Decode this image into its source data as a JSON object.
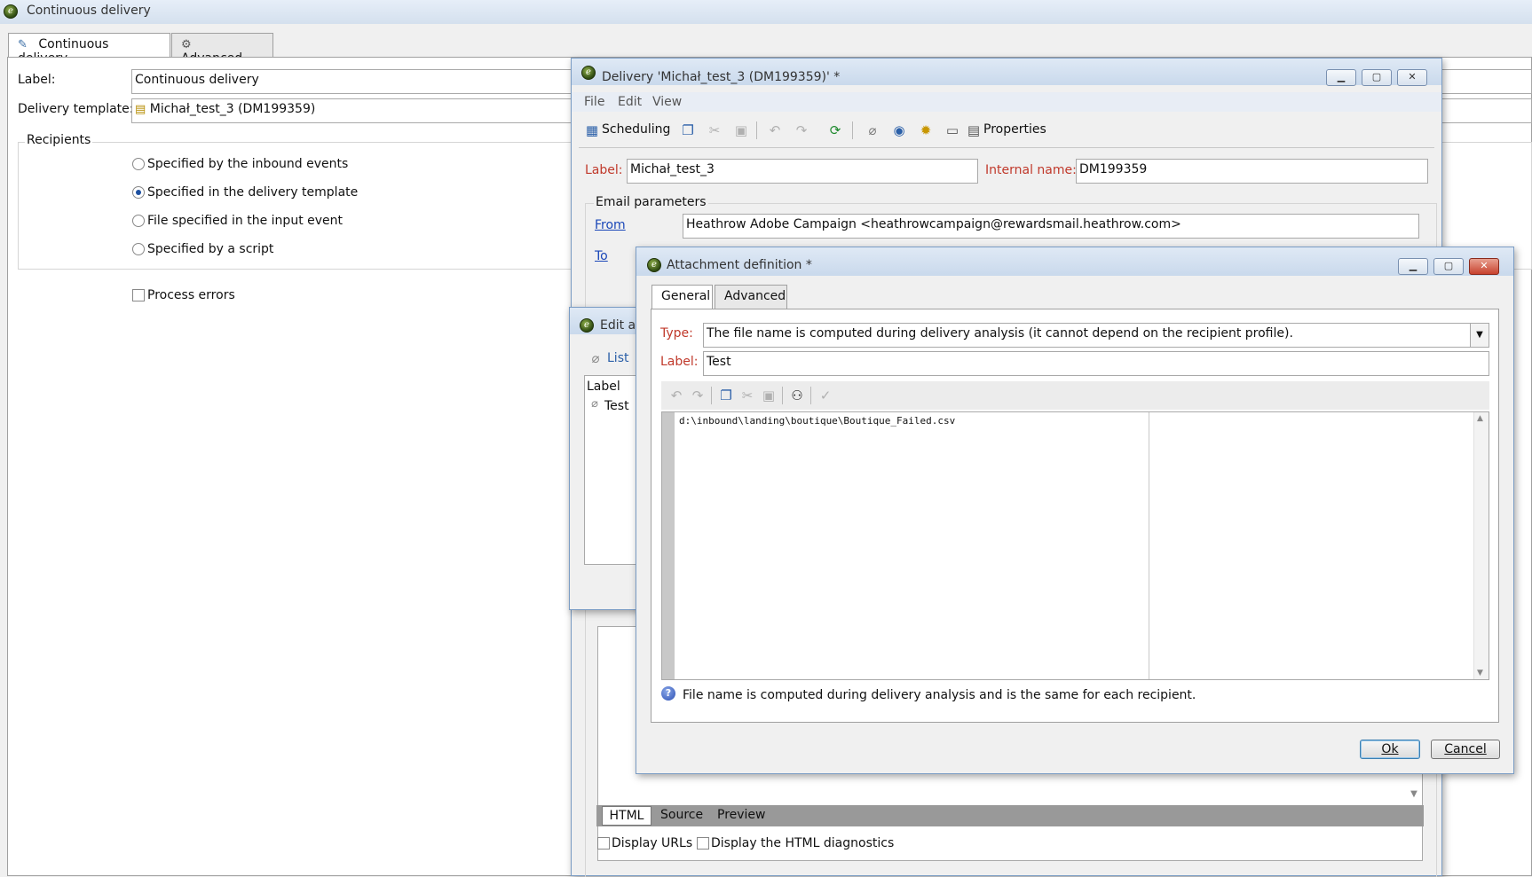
{
  "main_window": {
    "title": "Continuous delivery",
    "tabs": [
      "Continuous delivery",
      "Advanced"
    ],
    "label_caption": "Label:",
    "label_value": "Continuous delivery",
    "template_caption": "Delivery template:",
    "template_value": "Michał_test_3 (DM199359)",
    "recipients_caption": "Recipients",
    "recipient_options": [
      {
        "label": "Specified by the inbound events",
        "selected": false
      },
      {
        "label": "Specified in the delivery template",
        "selected": true
      },
      {
        "label": "File specified in the input event",
        "selected": false
      },
      {
        "label": "Specified by a script",
        "selected": false
      }
    ],
    "process_errors": "Process errors"
  },
  "delivery_window": {
    "title": "Delivery 'Michał_test_3 (DM199359)' *",
    "menu": [
      "File",
      "Edit",
      "View"
    ],
    "toolbar": {
      "scheduling": "Scheduling",
      "properties": "Properties"
    },
    "label_caption": "Label:",
    "label_value": "Michał_test_3",
    "internal_caption": "Internal name:",
    "internal_value": "DM199359",
    "email_params_caption": "Email parameters",
    "from_link": "From",
    "from_value": "Heathrow Adobe Campaign <heathrowcampaign@rewardsmail.heathrow.com>",
    "to_link": "To",
    "bottom_tabs": [
      "HTML",
      "Source",
      "Preview"
    ],
    "display_urls": "Display URLs",
    "display_diag": "Display the HTML diagnostics"
  },
  "edit_window": {
    "title": "Edit at",
    "list_label": "List",
    "column_label": "Label",
    "row": "Test"
  },
  "attachment_window": {
    "title": "Attachment definition *",
    "tabs": [
      "General",
      "Advanced"
    ],
    "type_caption": "Type:",
    "type_value": "The file name is computed during delivery analysis (it cannot depend on the recipient profile).",
    "label_caption": "Label:",
    "label_value": "Test",
    "editor_text": "d:\\inbound\\landing\\boutique\\Boutique_Failed.csv",
    "info_text": "File name is computed during delivery analysis and is the same for each recipient.",
    "ok": "Ok",
    "cancel": "Cancel"
  },
  "colors": {
    "required_label": "#c0392b",
    "link": "#1a47b8",
    "title_bar": "#c9d9ec"
  }
}
